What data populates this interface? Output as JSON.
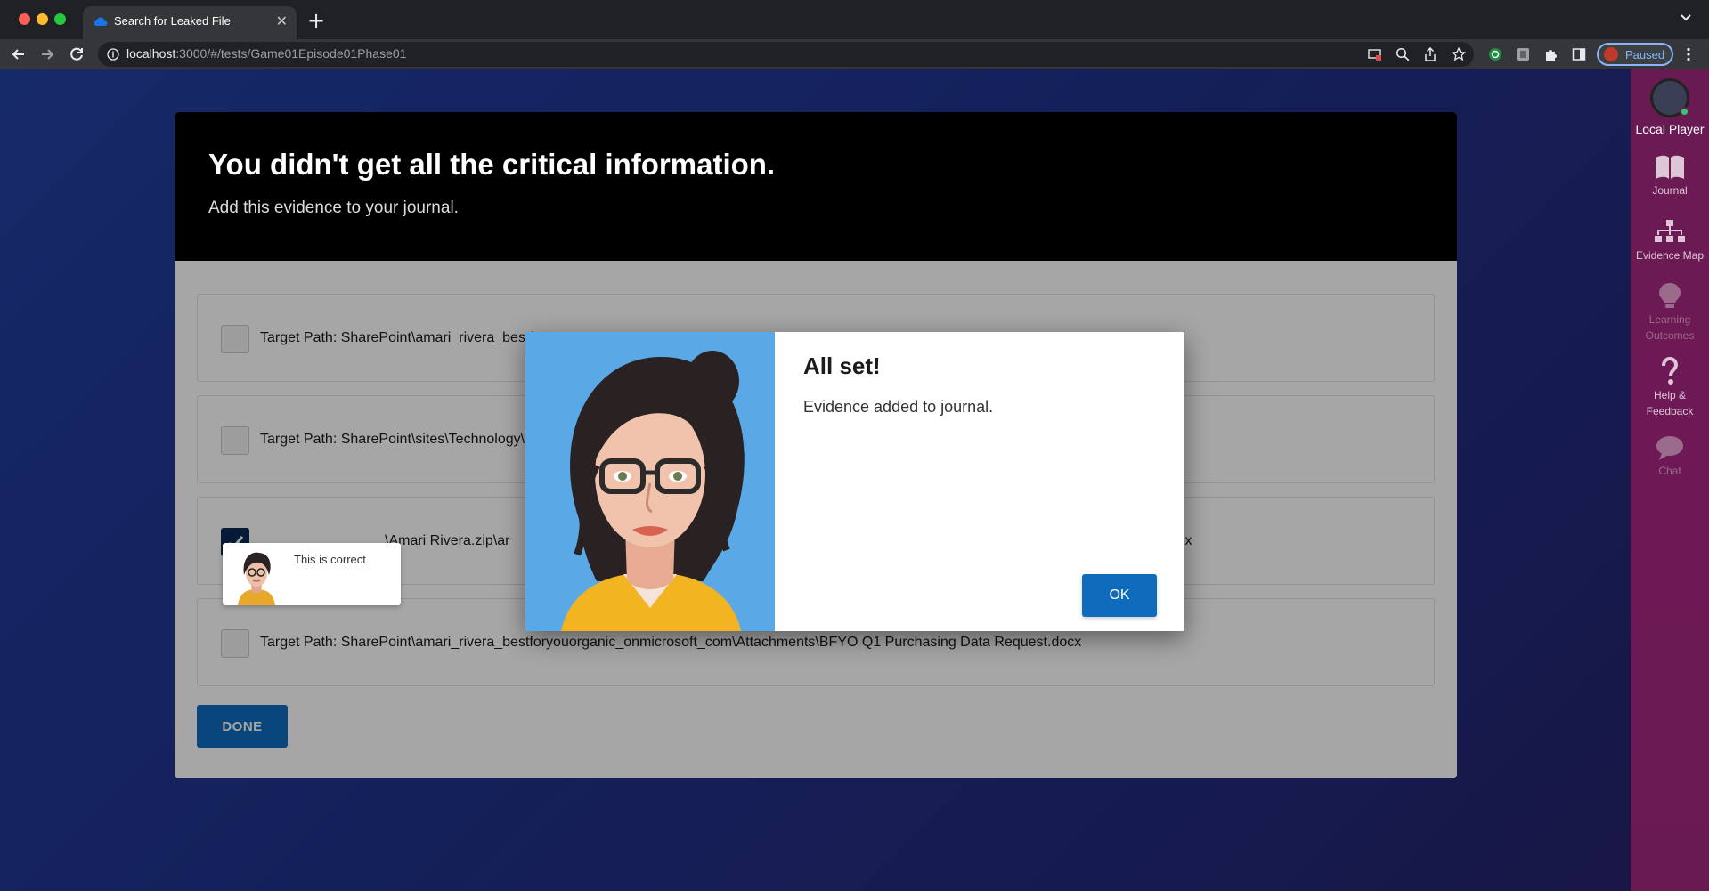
{
  "browser": {
    "tab_title": "Search for Leaked File",
    "close_glyph": "✕",
    "new_tab_glyph": "+",
    "url_host": "localhost",
    "url_rest": ":3000/#/tests/Game01Episode01Phase01",
    "profile_label": "Paused"
  },
  "sidebar": {
    "player_label": "Local Player",
    "items": [
      {
        "label": "Journal",
        "icon": "book-icon"
      },
      {
        "label": "Evidence Map",
        "icon": "sitemap-icon"
      },
      {
        "label": "Learning Outcomes",
        "icon": "lightbulb-icon"
      },
      {
        "label": "Help & Feedback",
        "icon": "question-icon"
      },
      {
        "label": "Chat",
        "icon": "chat-bubble-icon"
      }
    ]
  },
  "card": {
    "title": "You didn't get all the critical information.",
    "subtitle": "Add this evidence to your journal.",
    "options": [
      {
        "text": "Target Path: SharePoint\\amari_rivera_bestfo",
        "tail": "",
        "checked": false
      },
      {
        "text": "Target Path: SharePoint\\sites\\Technology\\S",
        "tail": "",
        "checked": false
      },
      {
        "text": "\\Amari Rivera.zip\\ar",
        "tail": "lsx",
        "checked": true
      },
      {
        "text": "Target Path: SharePoint\\amari_rivera_bestforyouorganic_onmicrosoft_com\\Attachments\\BFYO Q1 Purchasing Data Request.docx",
        "tail": "",
        "checked": false
      }
    ],
    "done_label": "DONE"
  },
  "feedback": {
    "text": "This is correct"
  },
  "modal": {
    "title": "All set!",
    "message": "Evidence added to journal.",
    "ok_label": "OK"
  },
  "colors": {
    "accent_blue": "#0f6cbd",
    "sidebar": "#6a1a52",
    "header": "#000000",
    "portrait_bg": "#5aa9e6"
  }
}
